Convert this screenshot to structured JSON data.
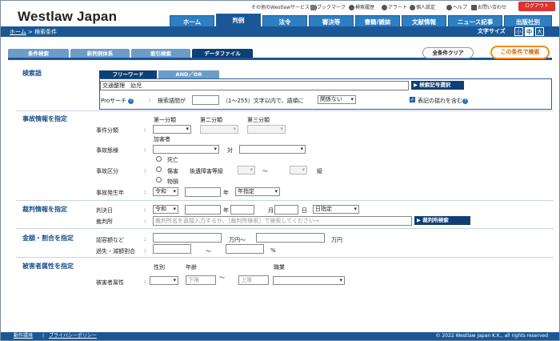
{
  "header": {
    "logo": "Westlaw Japan",
    "utility": {
      "other_services": "その他のWestlawサービス",
      "bookmark": "ブックマーク",
      "history": "検索履歴",
      "alert": "アラート",
      "personal": "個人設定",
      "help": "ヘルプ",
      "contact": "お問い合わせ",
      "logout": "ログアウト"
    },
    "tabs": [
      "ホーム",
      "判例",
      "法令",
      "審決等",
      "書籍/雑誌",
      "文献情報",
      "ニュース記事",
      "出版社別"
    ],
    "active_tab": "判例",
    "breadcrumb": {
      "home": "ホーム",
      "sep": ">",
      "current": "検索条件"
    },
    "font_size_label": "文字サイズ",
    "font_sizes": [
      "小",
      "中",
      "大"
    ],
    "font_size_selected": "中"
  },
  "subtabs": [
    "条件検索",
    "新判例体系",
    "索引検索",
    "データファイル"
  ],
  "active_subtab": "データファイル",
  "actions": {
    "clear": "全条件クリア",
    "search": "この条件で検索"
  },
  "keyword": {
    "heading": "検索語",
    "tabs": [
      "フリーワード",
      "AND／OR"
    ],
    "value": "交通整理　幼児",
    "select_code_button": "検索記号選択",
    "pro_search_label": "Proサーチ",
    "colon": ":",
    "distance_prefix": "検索語間が",
    "distance_value": "",
    "distance_suffix": "（1〜255）文字以内で、語順に",
    "order_value": "関係ない",
    "variant_checkbox_label": "表記の揺れを含む",
    "variant_checked": true
  },
  "accident": {
    "heading": "事故情報を指定",
    "cat_headers": [
      "第一分類",
      "第二分類",
      "第三分類"
    ],
    "type_label": "事件分類",
    "perpetrator_label": "加害者",
    "mode_label": "事故態様",
    "vs": "対",
    "category_label": "事故区分",
    "radio_death": "死亡",
    "radio_injury": "傷害",
    "disability_label": "後遺障害等級",
    "tilde": "〜",
    "grade_suffix": "級",
    "radio_property": "物損",
    "date_label": "事故発生年",
    "era_value": "令和",
    "year_suffix": "年",
    "year_mode": "年指定"
  },
  "judgment": {
    "heading": "裁判情報を指定",
    "date_label": "判決日",
    "era_value": "令和",
    "year_suffix": "年",
    "month_suffix": "月",
    "day_suffix": "日",
    "date_mode": "日指定",
    "court_label": "裁判所",
    "court_placeholder": "裁判所名を直接入力するか、［裁判所検索］で検索してください→",
    "court_search_button": "裁判所検索"
  },
  "amount": {
    "heading": "金額・割合を指定",
    "approved_label": "認容額など",
    "yen_tilde": "万円〜",
    "yen": "万円",
    "fault_label": "過失・減額割合",
    "tilde": "〜",
    "percent": "%"
  },
  "victim": {
    "heading": "被害者属性を指定",
    "sex_header": "性別",
    "age_header": "年齢",
    "job_header": "職業",
    "attr_label": "被害者属性",
    "age_lower_placeholder": "下限",
    "tilde": "〜",
    "age_upper_placeholder": "上限"
  },
  "footer": {
    "links": [
      "動作環境",
      "プライバシーポリシー"
    ],
    "copyright": "© 2022 Westlaw Japan K.K., all rights reserved"
  },
  "colors": {
    "nav": "#1b5797",
    "tab": "#2e7ec2",
    "accent": "#f08c19",
    "logout": "#dd3333"
  }
}
